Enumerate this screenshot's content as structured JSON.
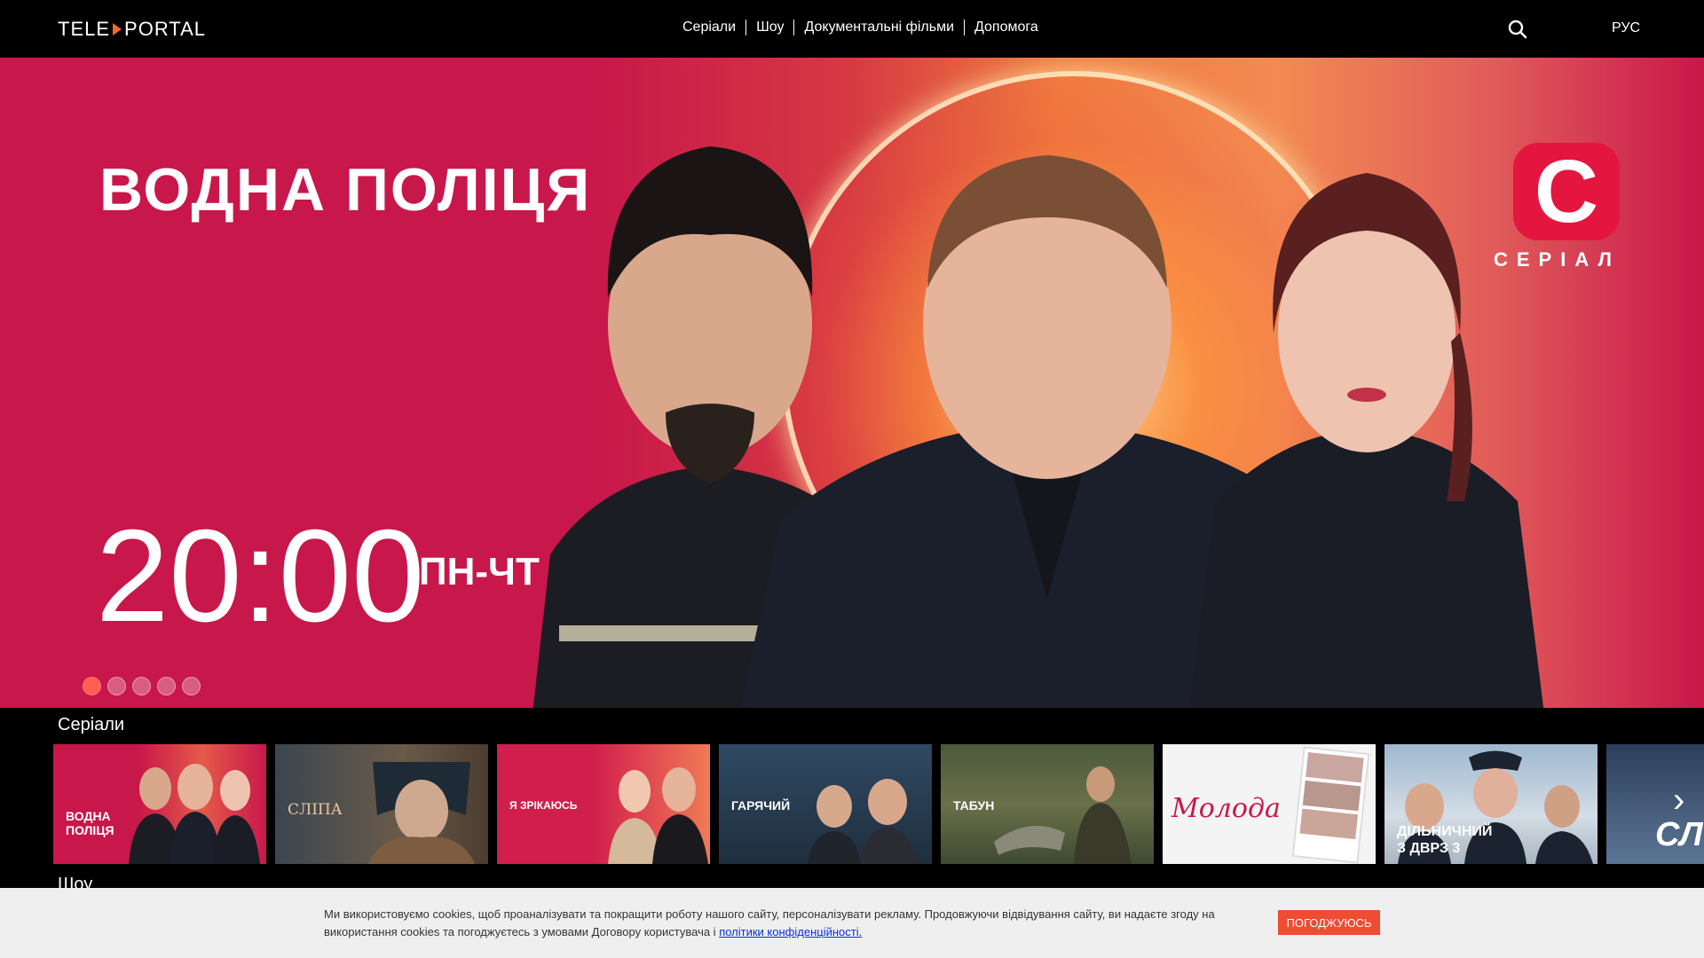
{
  "header": {
    "logo_left": "TELE",
    "logo_right": "PORTAL",
    "nav": [
      "Серіали",
      "Шоу",
      "Документальні фільми",
      "Допомога"
    ],
    "lang": "РУС"
  },
  "hero": {
    "title": "ВОДНА ПОЛІЦЯ",
    "time": "20:00",
    "days": "ПН-ЧТ",
    "channel_letter": "С",
    "channel_sub": "СЕРІАЛ",
    "slides_count": 5,
    "active_slide": 1
  },
  "sections": {
    "series_title": "Серіали",
    "show_title": "Шоу"
  },
  "series_cards": [
    {
      "label": "ВОДНА\nПОЛІЦЯ"
    },
    {
      "label": "СЛІПА"
    },
    {
      "label": "Я ЗРІКАЮСЬ"
    },
    {
      "label": "ГАРЯЧИЙ"
    },
    {
      "label": "ТАБУН"
    },
    {
      "label": "Молода"
    },
    {
      "label": "ДІЛЬНИЧНИЙ\nЗ ДВРЗ 3"
    },
    {
      "label": "СЛ"
    }
  ],
  "cookie": {
    "text": "Ми використовуємо cookies, щоб проаналізувати та покращити роботу нашого сайту, персоналізувати рекламу. Продовжуючи відвідування сайту, ви надаєте згоду на використання cookies та погоджуєтесь з умовами Договору користувача і ",
    "link": "політики конфіденційності.",
    "button": "ПОГОДЖУЮСЬ"
  },
  "colors": {
    "accent": "#f04b33",
    "hero_red": "#c8174a",
    "channel_red": "#e4163f"
  }
}
